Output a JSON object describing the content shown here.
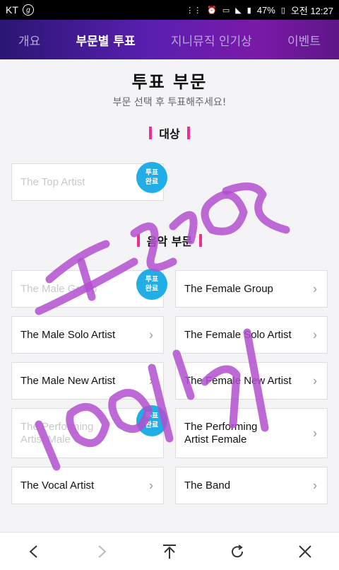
{
  "status_bar": {
    "carrier": "KT",
    "carrier_icon": "g",
    "battery": "47%",
    "time": "오전 12:27"
  },
  "nav": {
    "tabs": [
      {
        "label": "개요",
        "active": false
      },
      {
        "label": "부문별 투표",
        "active": true
      },
      {
        "label": "지니뮤직 인기상",
        "active": false
      },
      {
        "label": "이벤트",
        "active": false
      }
    ]
  },
  "page": {
    "title": "투표 부문",
    "subtitle": "부문 선택 후 투표해주세요!"
  },
  "sections": {
    "grand": {
      "heading": "대상",
      "items": [
        {
          "label": "The Top Artist",
          "voted": true,
          "badge": "투표\n완료"
        }
      ]
    },
    "music": {
      "heading": "음악 부문",
      "items": [
        {
          "label": "The Male Group",
          "voted": true,
          "badge": "투표\n완료"
        },
        {
          "label": "The Female Group",
          "voted": false
        },
        {
          "label": "The Male Solo Artist",
          "voted": false
        },
        {
          "label": "The Female Solo Artist",
          "voted": false
        },
        {
          "label": "The Male New Artist",
          "voted": false
        },
        {
          "label": "The Female New Artist",
          "voted": false
        },
        {
          "label": "The Performing Artist Male",
          "voted": true,
          "badge": "투표\n완료"
        },
        {
          "label": "The Performing Artist Female",
          "voted": false
        },
        {
          "label": "The Vocal Artist",
          "voted": false
        },
        {
          "label": "The Band",
          "voted": false
        }
      ]
    }
  },
  "bottom_bar": {
    "buttons": [
      "back-arrow-icon",
      "forward-arrow-icon",
      "scroll-top-icon",
      "refresh-icon",
      "close-icon"
    ]
  },
  "annotation": {
    "color": "#b24fcf"
  }
}
